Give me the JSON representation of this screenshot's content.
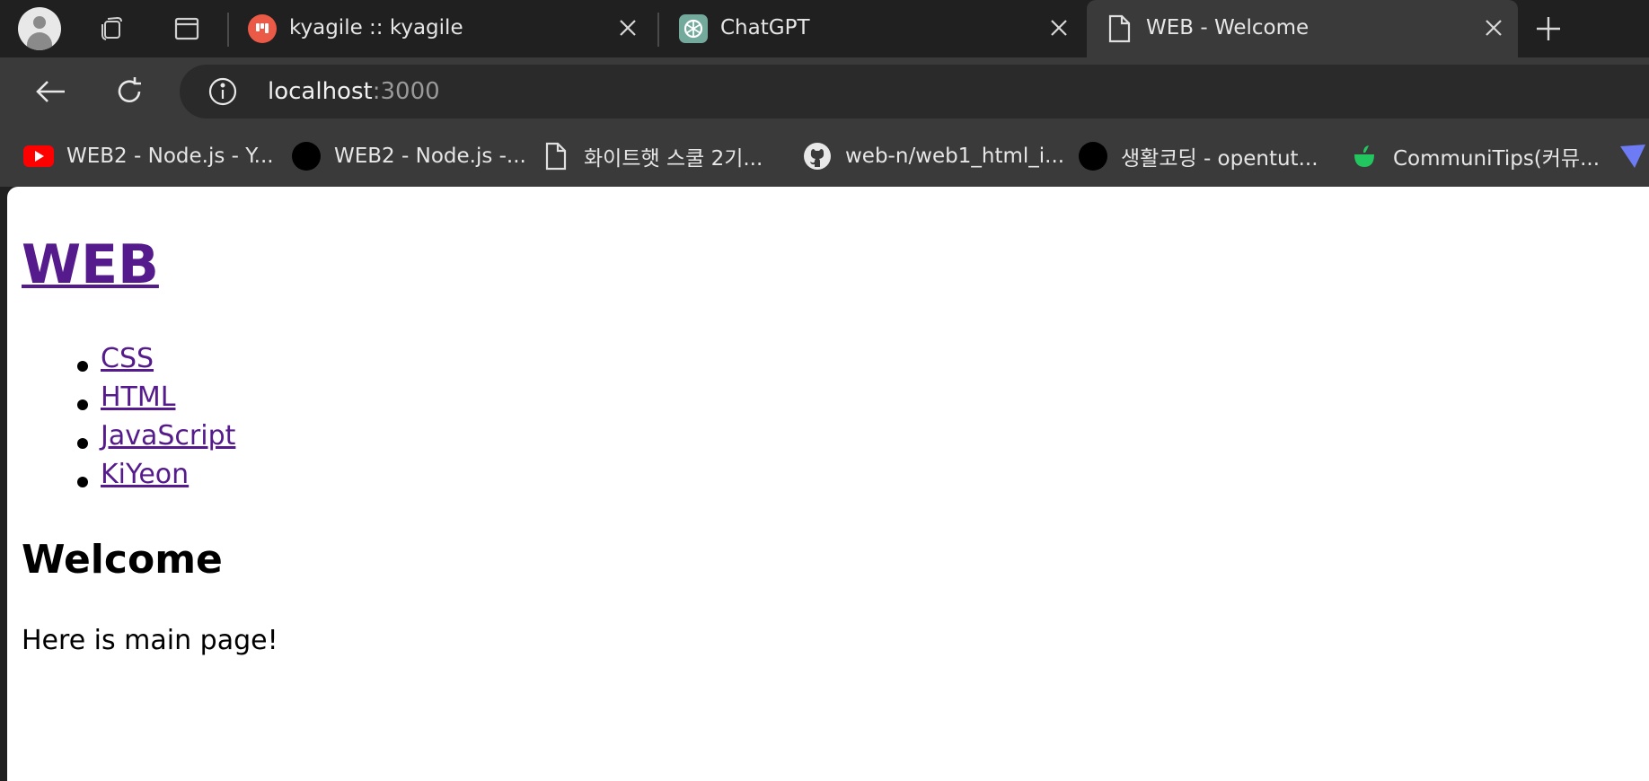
{
  "browser": {
    "tabs": [
      {
        "title": "kyagile :: kyagile",
        "icon": "trello-icon",
        "active": false
      },
      {
        "title": "ChatGPT",
        "icon": "chatgpt-icon",
        "active": false
      },
      {
        "title": "WEB - Welcome",
        "icon": "document-icon",
        "active": true
      }
    ],
    "address": {
      "host": "localhost",
      "port": ":3000"
    },
    "bookmarks": [
      {
        "label": "WEB2 - Node.js - Y...",
        "icon": "youtube-icon"
      },
      {
        "label": "WEB2 - Node.js -...",
        "icon": "black-circle-icon"
      },
      {
        "label": "화이트햇 스쿨 2기...",
        "icon": "document-icon"
      },
      {
        "label": "web-n/web1_html_i...",
        "icon": "github-icon"
      },
      {
        "label": "생활코딩 - opentut...",
        "icon": "black-circle-icon"
      },
      {
        "label": "CommuniTips(커뮤...",
        "icon": "cup-icon"
      }
    ],
    "colors": {
      "chrome_dark": "#202020",
      "toolbar": "#3a3a3a",
      "link_visited": "#551a8b"
    }
  },
  "page": {
    "heading": "WEB",
    "nav": [
      "CSS",
      "HTML",
      "JavaScript",
      "KiYeon"
    ],
    "subheading": "Welcome",
    "body": "Here is main page!"
  }
}
